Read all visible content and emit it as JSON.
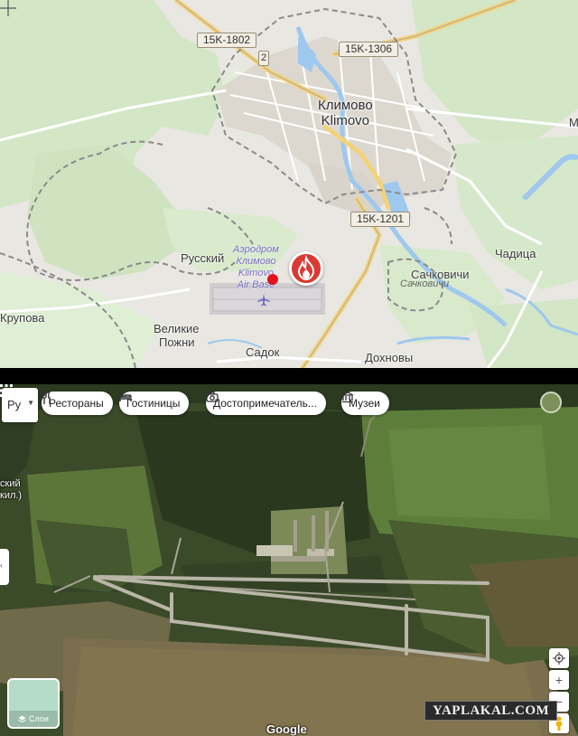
{
  "top_map": {
    "road_shields": [
      "15K-1802",
      "2",
      "15K-1306",
      "15K-1201"
    ],
    "city": {
      "name_ru": "Климово",
      "name_en": "Klimovo"
    },
    "places": {
      "russky": "Русский",
      "chaditsa": "Чадица",
      "sachkovichi": "Сачковичи",
      "sachkovichi_alt": "Сачковичи",
      "velikie_line1": "Великие",
      "velikie_line2": "Пожни",
      "sadok": "Садок",
      "dokhnovy": "Дохновы",
      "krupovka": "Крупова",
      "edge_m": "М"
    },
    "airbase": {
      "line1": "Аэродром",
      "line2": "Климово",
      "line3": "Klimovo",
      "line4": "Air Base"
    },
    "marker_icon": "fire-icon",
    "colors": {
      "background": "#e9e7e2",
      "forest": "#d3e6c6",
      "urban": "#dcd8d0",
      "water": "#9ec8ee",
      "road": "#f3d27a",
      "boundary": "#8a8a8a",
      "fire": "#d93a33"
    }
  },
  "satellite": {
    "layer_select": "Ру",
    "chips": [
      {
        "label": "Рестораны",
        "icon": "fork-knife-icon"
      },
      {
        "label": "Гостиницы",
        "icon": "bed-icon"
      },
      {
        "label": "Достопримечатель...",
        "icon": "camera-icon"
      },
      {
        "label": "Музеи",
        "icon": "museum-icon"
      }
    ],
    "edge_label_line1": "ский",
    "edge_label_line2": "кил.)",
    "layers_label": "Слои",
    "google": "Google",
    "watermark": "YAPLAKAL.COM",
    "colors": {
      "forest": "#2f3d22",
      "field": "#5a7a3c",
      "runway": "#b9b6a8"
    }
  }
}
